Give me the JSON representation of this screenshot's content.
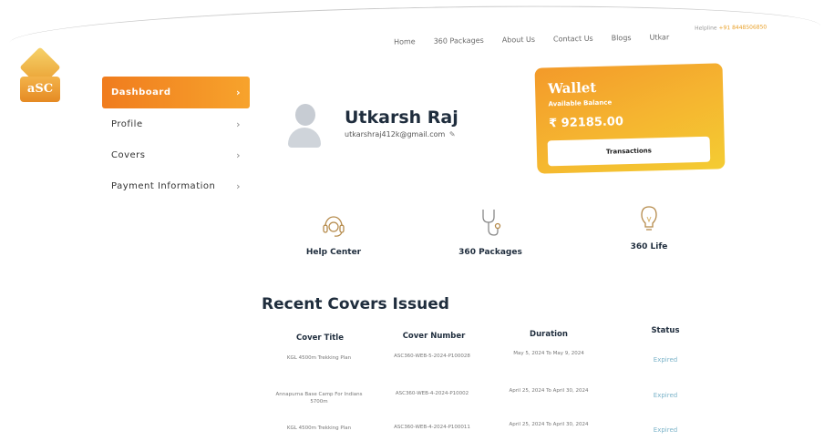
{
  "logo": {
    "text": "aSC"
  },
  "nav": {
    "items": [
      "Home",
      "360 Packages",
      "About Us",
      "Contact Us",
      "Blogs",
      "Utkar"
    ],
    "phone_label": "Helpline",
    "phone": "+91 8448506850"
  },
  "sidebar": {
    "items": [
      {
        "label": "Dashboard",
        "active": true
      },
      {
        "label": "Profile",
        "active": false
      },
      {
        "label": "Covers",
        "active": false
      },
      {
        "label": "Payment Information",
        "active": false
      }
    ]
  },
  "profile": {
    "name": "Utkarsh Raj",
    "email": "utkarshraj412k@gmail.com"
  },
  "wallet": {
    "title": "Wallet",
    "subtitle": "Available Balance",
    "amount": "₹ 92185.00",
    "button": "Transactions"
  },
  "quick_links": [
    {
      "label": "Help Center",
      "icon": "headset-icon"
    },
    {
      "label": "360 Packages",
      "icon": "stethoscope-icon"
    },
    {
      "label": "360 Life",
      "icon": "lightbulb-icon"
    }
  ],
  "recent": {
    "title": "Recent Covers Issued",
    "columns": [
      "Cover Title",
      "Cover Number",
      "Duration",
      "Status"
    ],
    "rows": [
      {
        "title": "KGL 4500m Trekking Plan",
        "number": "ASC360-WEB-5-2024-P100028",
        "duration": "May 5, 2024 To May 9, 2024",
        "status": "Expired"
      },
      {
        "title": "Annapurna Base Camp For Indians 5700m",
        "number": "ASC360-WEB-4-2024-P10002",
        "duration": "April 25, 2024 To April 30, 2024",
        "status": "Expired"
      },
      {
        "title": "KGL 4500m Trekking Plan",
        "number": "ASC360-WEB-4-2024-P100011",
        "duration": "April 25, 2024 To April 30, 2024",
        "status": "Expired"
      }
    ]
  },
  "colors": {
    "accent": "#f07c1e",
    "wallet_end": "#f4cc32",
    "status": "#7bb3c9"
  }
}
